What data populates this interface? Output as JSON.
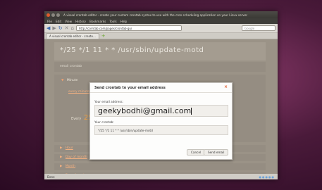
{
  "window": {
    "title": "A visual crontab editor - create your custom crontab syntax to use with the cron scheduling application on your Linux server"
  },
  "menubar": [
    "File",
    "Edit",
    "View",
    "History",
    "Bookmarks",
    "Tools",
    "Help"
  ],
  "navbar": {
    "url": "http://corntab.com/pages/crontab-gui",
    "search_placeholder": "Google"
  },
  "tabs": [
    {
      "label": "A visual crontab editor - create..."
    }
  ],
  "page": {
    "cron_expression": "*/25  */1  11  *  *  /usr/sbin/update-motd",
    "crontab_label": "email crontab",
    "minute_section": "Minute",
    "minute_link": "every minute",
    "every_label": "Every",
    "every_value": "25",
    "sections": [
      "Hour",
      "Day of month",
      "Month",
      "Day of week"
    ]
  },
  "status": {
    "left": "Done"
  },
  "dialog": {
    "title": "Send crontab to your email address",
    "email_label": "Your email address:",
    "email_value": "geekybodhi@gmail.com",
    "crontab_label": "Your crontab:",
    "crontab_value": "*/25 */1 11 * * /usr/sbin/update-motd",
    "cancel_label": "Cancel",
    "send_label": "Send email"
  },
  "icons": {
    "back": "back-arrow-icon",
    "forward": "forward-arrow-icon",
    "reload": "reload-icon",
    "stop": "stop-icon",
    "home": "home-icon",
    "close": "close-icon"
  },
  "colors": {
    "accent": "#f0a040",
    "link": "#f3b080",
    "close": "#e05a2b"
  }
}
